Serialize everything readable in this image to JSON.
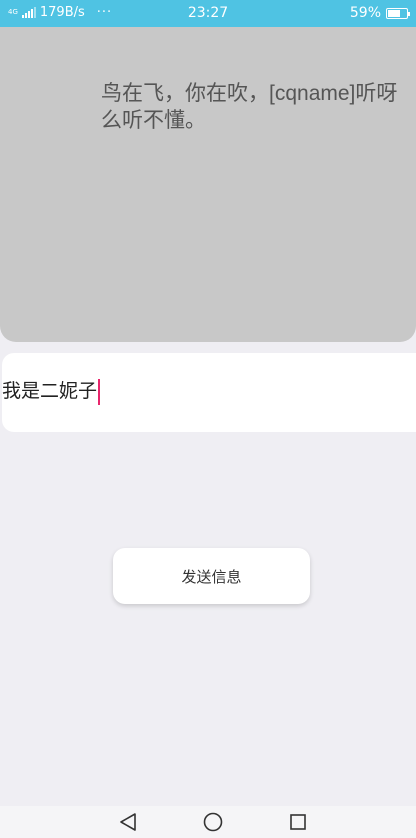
{
  "status_bar": {
    "network_type": "4G",
    "speed": "179B/s",
    "more": "···",
    "time": "23:27",
    "battery": "59%",
    "bg_color": "#4fc3e3"
  },
  "message": {
    "text": "鸟在飞，你在吹，[cqname]听呀么听不懂。"
  },
  "input": {
    "value": "我是二妮子"
  },
  "send_button": {
    "label": "发送信息"
  },
  "nav": {
    "back": "back-icon",
    "home": "home-icon",
    "recent": "recent-apps-icon"
  }
}
